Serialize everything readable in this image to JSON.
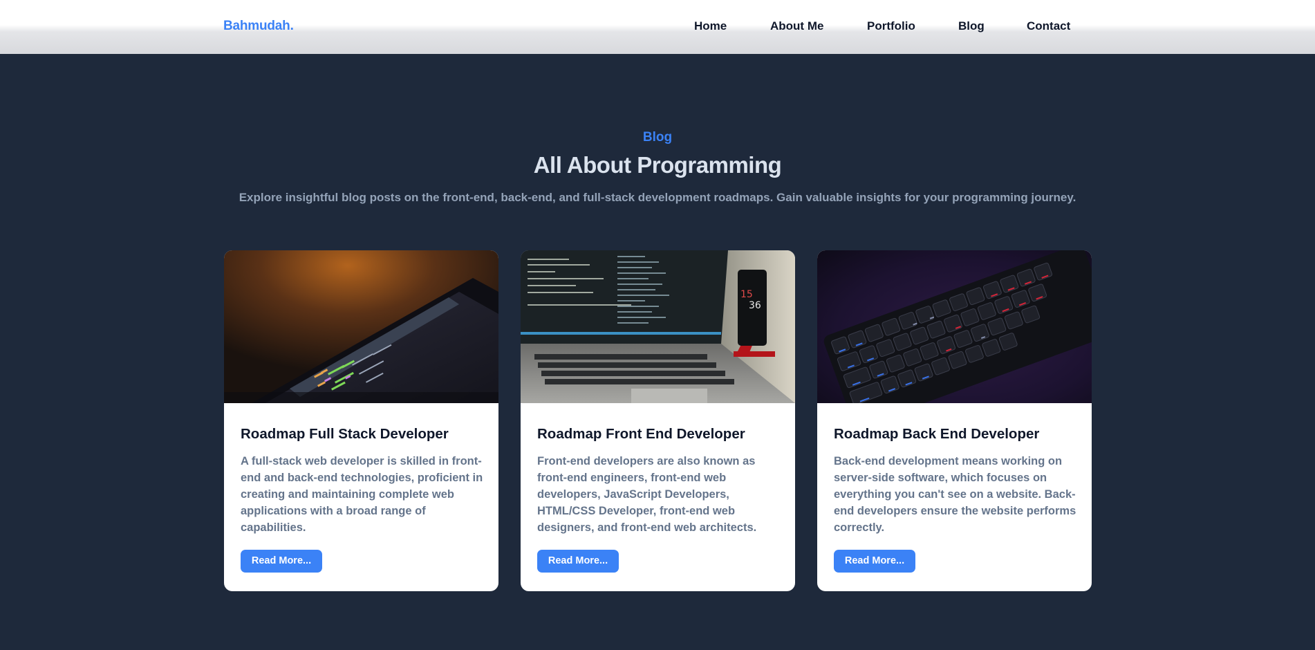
{
  "brand": {
    "logo": "Bahmudah."
  },
  "nav": {
    "home": "Home",
    "about": "About Me",
    "portfolio": "Portfolio",
    "blog": "Blog",
    "contact": "Contact"
  },
  "section": {
    "eyebrow": "Blog",
    "title": "All About Programming",
    "description": "Explore insightful blog posts on the front-end, back-end, and full-stack development roadmaps. Gain valuable insights for your programming journey."
  },
  "cards": [
    {
      "title": "Roadmap Full Stack Developer",
      "text": "A full-stack web developer is skilled in front-end and back-end technologies, proficient in creating and maintaining complete web applications with a broad range of capabilities.",
      "button": "Read More...",
      "image": "laptop-code-photo"
    },
    {
      "title": "Roadmap Front End Developer",
      "text": "Front-end developers are also known as front-end engineers, front-end web developers, JavaScript Developers, HTML/CSS Developer, front-end web designers, and front-end web architects.",
      "button": "Read More...",
      "image": "laptop-phone-photo",
      "phone_clock": "15 36"
    },
    {
      "title": "Roadmap Back End Developer",
      "text": "Back-end development means working on server-side software, which focuses on everything you can't see on a website. Back-end developers ensure the website performs correctly.",
      "button": "Read More...",
      "image": "rgb-keyboard-photo"
    }
  ],
  "colors": {
    "background": "#1e293b",
    "accent": "#3b82f6",
    "title": "#dbe3ee",
    "muted": "#94a3b8",
    "card_text": "#64748b",
    "card_title": "#0f172a"
  }
}
